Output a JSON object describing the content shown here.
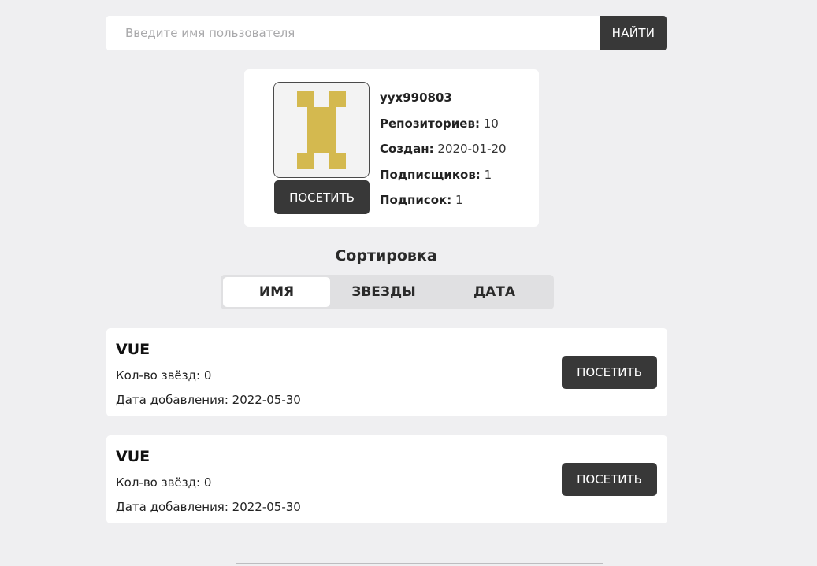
{
  "search": {
    "placeholder": "Введите имя пользователя",
    "value": "",
    "button_label": "НАЙТИ"
  },
  "profile": {
    "avatar_icon": "identicon-avatar",
    "avatar_color": "#d4b94f",
    "visit_label": "ПОСЕТИТЬ",
    "login": "yyx990803",
    "repos_label": "Репозиториев:",
    "repos_value": "10",
    "created_label": "Создан:",
    "created_value": "2020-01-20",
    "followers_label": "Подписщиков:",
    "followers_value": "1",
    "following_label": "Подписок:",
    "following_value": "1"
  },
  "sort": {
    "title": "Сортировка",
    "tabs": [
      {
        "label": "ИМЯ",
        "active": true
      },
      {
        "label": "ЗВЕЗДЫ",
        "active": false
      },
      {
        "label": "ДАТА",
        "active": false
      }
    ]
  },
  "repos": [
    {
      "name": "VUE",
      "stars_text": "Кол-во звёзд: 0",
      "date_text": "Дата добавления: 2022-05-30",
      "visit_label": "ПОСЕТИТЬ"
    },
    {
      "name": "VUE",
      "stars_text": "Кол-во звёзд: 0",
      "date_text": "Дата добавления: 2022-05-30",
      "visit_label": "ПОСЕТИТЬ"
    }
  ],
  "colors": {
    "background": "#efeff1",
    "button": "#383838",
    "accent_identicon": "#d4b94f"
  }
}
